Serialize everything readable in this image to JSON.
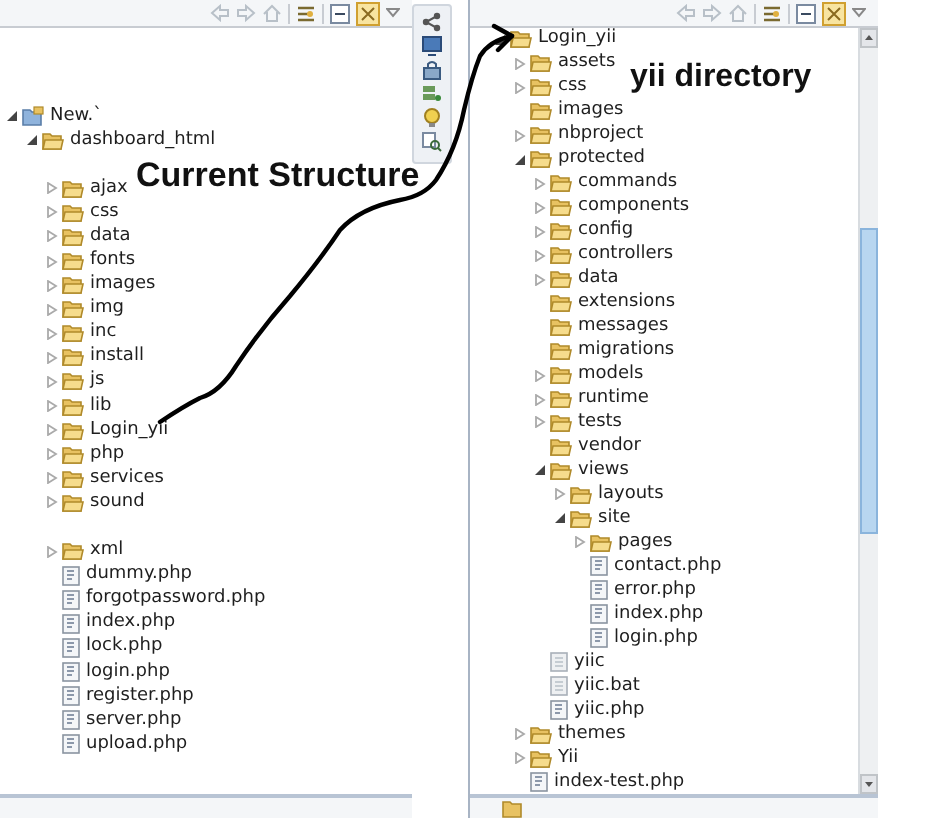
{
  "left_panel": {
    "tree": [
      {
        "label": "New.`",
        "kind": "project",
        "expanded": true,
        "children": [
          {
            "label": "dashboard_html",
            "kind": "folder",
            "expanded": true,
            "children": [
              {
                "label": "ajax",
                "kind": "folder",
                "expanded": false,
                "gap_before": true
              },
              {
                "label": "css",
                "kind": "folder",
                "expanded": false
              },
              {
                "label": "data",
                "kind": "folder",
                "expanded": false
              },
              {
                "label": "fonts",
                "kind": "folder",
                "expanded": false
              },
              {
                "label": "images",
                "kind": "folder",
                "expanded": false
              },
              {
                "label": "img",
                "kind": "folder",
                "expanded": false
              },
              {
                "label": "inc",
                "kind": "folder",
                "expanded": false
              },
              {
                "label": "install",
                "kind": "folder",
                "expanded": false
              },
              {
                "label": "js",
                "kind": "folder",
                "expanded": false
              },
              {
                "label": "lib",
                "kind": "folder",
                "expanded": false
              },
              {
                "label": "Login_yii",
                "kind": "folder",
                "expanded": false
              },
              {
                "label": "php",
                "kind": "folder",
                "expanded": false
              },
              {
                "label": "services",
                "kind": "folder",
                "expanded": false
              },
              {
                "label": "sound",
                "kind": "folder",
                "expanded": false
              },
              {
                "label": "xml",
                "kind": "folder",
                "expanded": false,
                "gap_before": true
              },
              {
                "label": "dummy.php",
                "kind": "file"
              },
              {
                "label": "forgotpassword.php",
                "kind": "file"
              },
              {
                "label": "index.php",
                "kind": "file"
              },
              {
                "label": "lock.php",
                "kind": "file"
              },
              {
                "label": "login.php",
                "kind": "file"
              },
              {
                "label": "register.php",
                "kind": "file"
              },
              {
                "label": "server.php",
                "kind": "file"
              },
              {
                "label": "upload.php",
                "kind": "file"
              }
            ]
          }
        ]
      }
    ]
  },
  "annotations": [
    {
      "text": "Current Structure"
    },
    {
      "text": "yii directory"
    }
  ],
  "right_panel": {
    "tree": [
      {
        "label": "Login_yii",
        "kind": "folder",
        "expanded": true,
        "children": [
          {
            "label": "assets",
            "kind": "folder",
            "expanded": false
          },
          {
            "label": "css",
            "kind": "folder",
            "expanded": false
          },
          {
            "label": "images",
            "kind": "leaf-folder"
          },
          {
            "label": "nbproject",
            "kind": "folder",
            "expanded": false
          },
          {
            "label": "protected",
            "kind": "folder",
            "expanded": true,
            "children": [
              {
                "label": "commands",
                "kind": "folder",
                "expanded": false
              },
              {
                "label": "components",
                "kind": "folder",
                "expanded": false
              },
              {
                "label": "config",
                "kind": "folder",
                "expanded": false
              },
              {
                "label": "controllers",
                "kind": "folder",
                "expanded": false
              },
              {
                "label": "data",
                "kind": "folder",
                "expanded": false
              },
              {
                "label": "extensions",
                "kind": "leaf-folder"
              },
              {
                "label": "messages",
                "kind": "leaf-folder"
              },
              {
                "label": "migrations",
                "kind": "leaf-folder"
              },
              {
                "label": "models",
                "kind": "folder",
                "expanded": false
              },
              {
                "label": "runtime",
                "kind": "folder",
                "expanded": false
              },
              {
                "label": "tests",
                "kind": "folder",
                "expanded": false
              },
              {
                "label": "vendor",
                "kind": "leaf-folder"
              },
              {
                "label": "views",
                "kind": "folder",
                "expanded": true,
                "children": [
                  {
                    "label": "layouts",
                    "kind": "folder",
                    "expanded": false
                  },
                  {
                    "label": "site",
                    "kind": "folder",
                    "expanded": true,
                    "children": [
                      {
                        "label": "pages",
                        "kind": "folder",
                        "expanded": false
                      },
                      {
                        "label": "contact.php",
                        "kind": "file"
                      },
                      {
                        "label": "error.php",
                        "kind": "file"
                      },
                      {
                        "label": "index.php",
                        "kind": "file"
                      },
                      {
                        "label": "login.php",
                        "kind": "file"
                      }
                    ]
                  }
                ]
              },
              {
                "label": "yiic",
                "kind": "script"
              },
              {
                "label": "yiic.bat",
                "kind": "script"
              },
              {
                "label": "yiic.php",
                "kind": "file"
              }
            ]
          },
          {
            "label": "themes",
            "kind": "folder",
            "expanded": false
          },
          {
            "label": "Yii",
            "kind": "folder",
            "expanded": false
          },
          {
            "label": "index-test.php",
            "kind": "file"
          }
        ]
      }
    ]
  }
}
